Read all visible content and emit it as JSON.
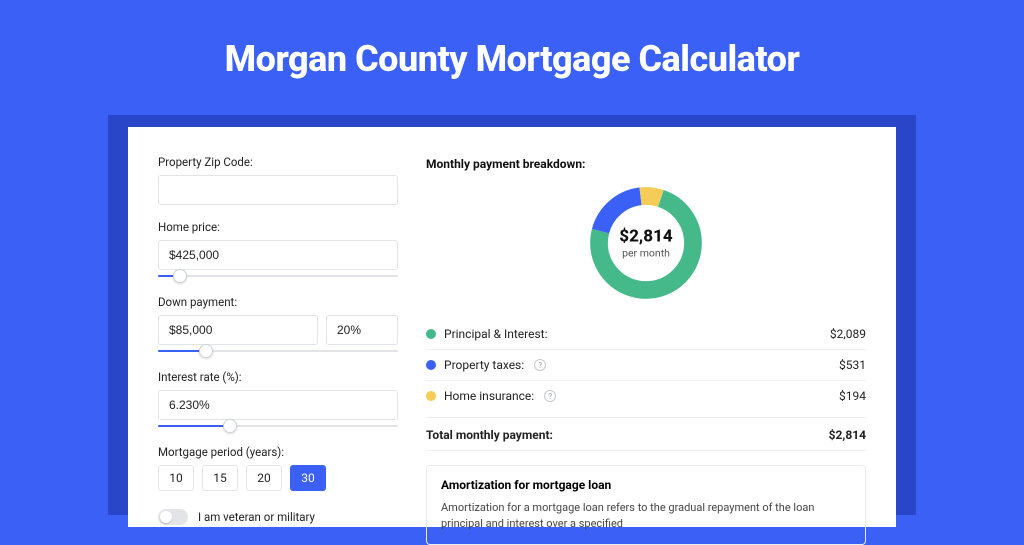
{
  "hero": {
    "title": "Morgan County Mortgage Calculator"
  },
  "form": {
    "zip_label": "Property Zip Code:",
    "zip_value": "",
    "home_price_label": "Home price:",
    "home_price_value": "$425,000",
    "home_price_slider_pct": 9,
    "down_payment_label": "Down payment:",
    "down_payment_value": "$85,000",
    "down_payment_pct": "20%",
    "down_payment_slider_pct": 20,
    "interest_label": "Interest rate (%):",
    "interest_value": "6.230%",
    "interest_slider_pct": 30,
    "period_label": "Mortgage period (years):",
    "period_options": [
      "10",
      "15",
      "20",
      "30"
    ],
    "period_selected": "30",
    "vet_label": "I am veteran or military",
    "vet_on": false
  },
  "breakdown": {
    "header": "Monthly payment breakdown:",
    "total": "$2,814",
    "per_month": "per month",
    "items": [
      {
        "label": "Principal & Interest:",
        "value": "$2,089",
        "color": "#46b98b",
        "pct": 74,
        "info": false
      },
      {
        "label": "Property taxes:",
        "value": "$531",
        "color": "#3b60f5",
        "pct": 19,
        "info": true
      },
      {
        "label": "Home insurance:",
        "value": "$194",
        "color": "#f4cc57",
        "pct": 7,
        "info": true
      }
    ],
    "total_label": "Total monthly payment:",
    "total_value": "$2,814"
  },
  "amort": {
    "title": "Amortization for mortgage loan",
    "text": "Amortization for a mortgage loan refers to the gradual repayment of the loan principal and interest over a specified"
  },
  "chart_data": {
    "type": "pie",
    "title": "Monthly payment breakdown",
    "categories": [
      "Principal & Interest",
      "Property taxes",
      "Home insurance"
    ],
    "values": [
      2089,
      531,
      194
    ],
    "colors": [
      "#46b98b",
      "#3b60f5",
      "#f4cc57"
    ],
    "total": 2814,
    "total_label": "$2,814 per month"
  }
}
